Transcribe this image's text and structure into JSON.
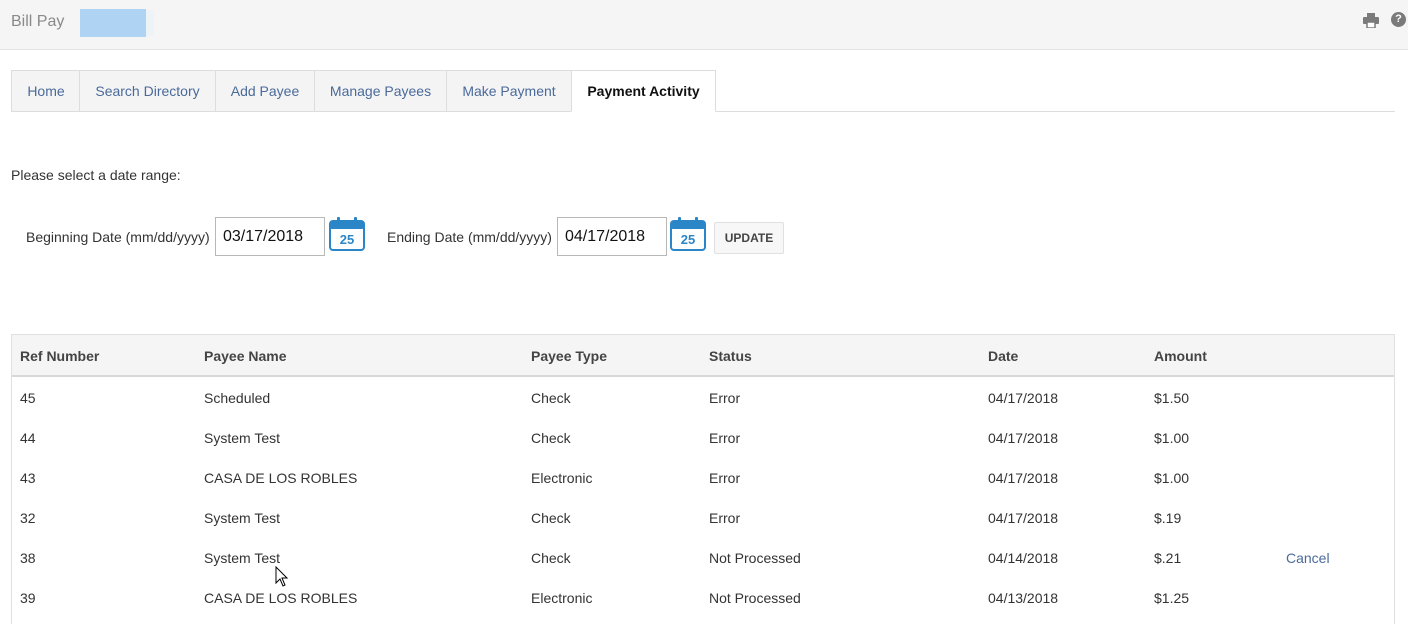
{
  "header": {
    "app_title": "Bill Pay",
    "icons": [
      "print-icon",
      "help-icon"
    ]
  },
  "tabs": [
    {
      "label": "Home",
      "active": false
    },
    {
      "label": "Search Directory",
      "active": false
    },
    {
      "label": "Add Payee",
      "active": false
    },
    {
      "label": "Manage Payees",
      "active": false
    },
    {
      "label": "Make Payment",
      "active": false
    },
    {
      "label": "Payment Activity",
      "active": true
    }
  ],
  "date_range": {
    "prompt": "Please select a date range:",
    "begin_label": "Beginning Date (mm/dd/yyyy)",
    "begin_value": "03/17/2018",
    "end_label": "Ending Date (mm/dd/yyyy)",
    "end_value": "04/17/2018",
    "calendar_day": "25",
    "update_label": "UPDATE"
  },
  "table": {
    "columns": [
      "Ref Number",
      "Payee Name",
      "Payee Type",
      "Status",
      "Date",
      "Amount"
    ],
    "rows": [
      {
        "ref": "45",
        "payee": "Scheduled",
        "type": "Check",
        "status": "Error",
        "date": "04/17/2018",
        "amount": "$1.50",
        "action": ""
      },
      {
        "ref": "44",
        "payee": "System Test",
        "type": "Check",
        "status": "Error",
        "date": "04/17/2018",
        "amount": "$1.00",
        "action": ""
      },
      {
        "ref": "43",
        "payee": "CASA DE LOS ROBLES",
        "type": "Electronic",
        "status": "Error",
        "date": "04/17/2018",
        "amount": "$1.00",
        "action": ""
      },
      {
        "ref": "32",
        "payee": "System Test",
        "type": "Check",
        "status": "Error",
        "date": "04/17/2018",
        "amount": "$.19",
        "action": ""
      },
      {
        "ref": "38",
        "payee": "System Test",
        "type": "Check",
        "status": "Not Processed",
        "date": "04/14/2018",
        "amount": "$.21",
        "action": "Cancel"
      },
      {
        "ref": "39",
        "payee": "CASA DE LOS ROBLES",
        "type": "Electronic",
        "status": "Not Processed",
        "date": "04/13/2018",
        "amount": "$1.25",
        "action": ""
      }
    ]
  },
  "colors": {
    "link": "#4a6a9a",
    "calendar_blue": "#2b86c8",
    "header_bg": "#f5f5f6"
  }
}
